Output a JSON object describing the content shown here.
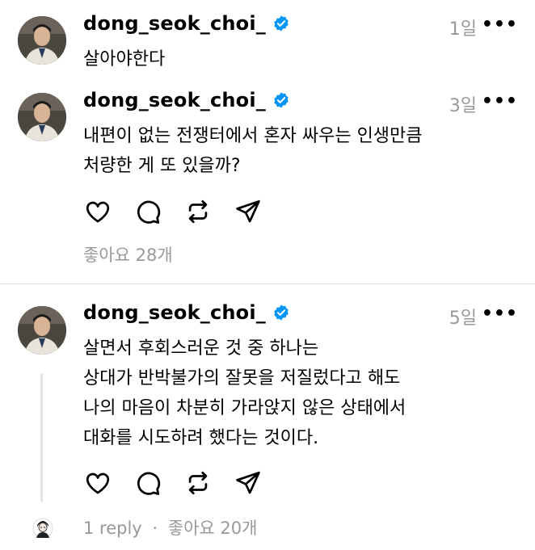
{
  "posts": [
    {
      "username": "dong_seok_choi_",
      "time": "1일",
      "lines": [
        "살아야한다"
      ]
    },
    {
      "username": "dong_seok_choi_",
      "time": "3일",
      "lines": [
        "내편이 없는 전쟁터에서 혼자 싸우는 인생만큼",
        "처량한 게 또 있을까?"
      ],
      "likes": "좋아요 28개"
    },
    {
      "username": "dong_seok_choi_",
      "time": "5일",
      "lines": [
        "살면서 후회스러운 것 중 하나는",
        "상대가 반박불가의 잘못을 저질렀다고 해도",
        "나의 마음이 차분히 가라앉지 않은 상태에서",
        "대화를 시도하려 했다는 것이다."
      ],
      "replies": "1 reply",
      "separator": "·",
      "likes": "좋아요 20개"
    }
  ],
  "more_glyph": "•••",
  "icons": [
    "heart-icon",
    "comment-icon",
    "repost-icon",
    "share-icon",
    "verified-badge-icon",
    "more-icon"
  ],
  "colors": {
    "verified": "#0095f6",
    "muted": "#999999"
  }
}
